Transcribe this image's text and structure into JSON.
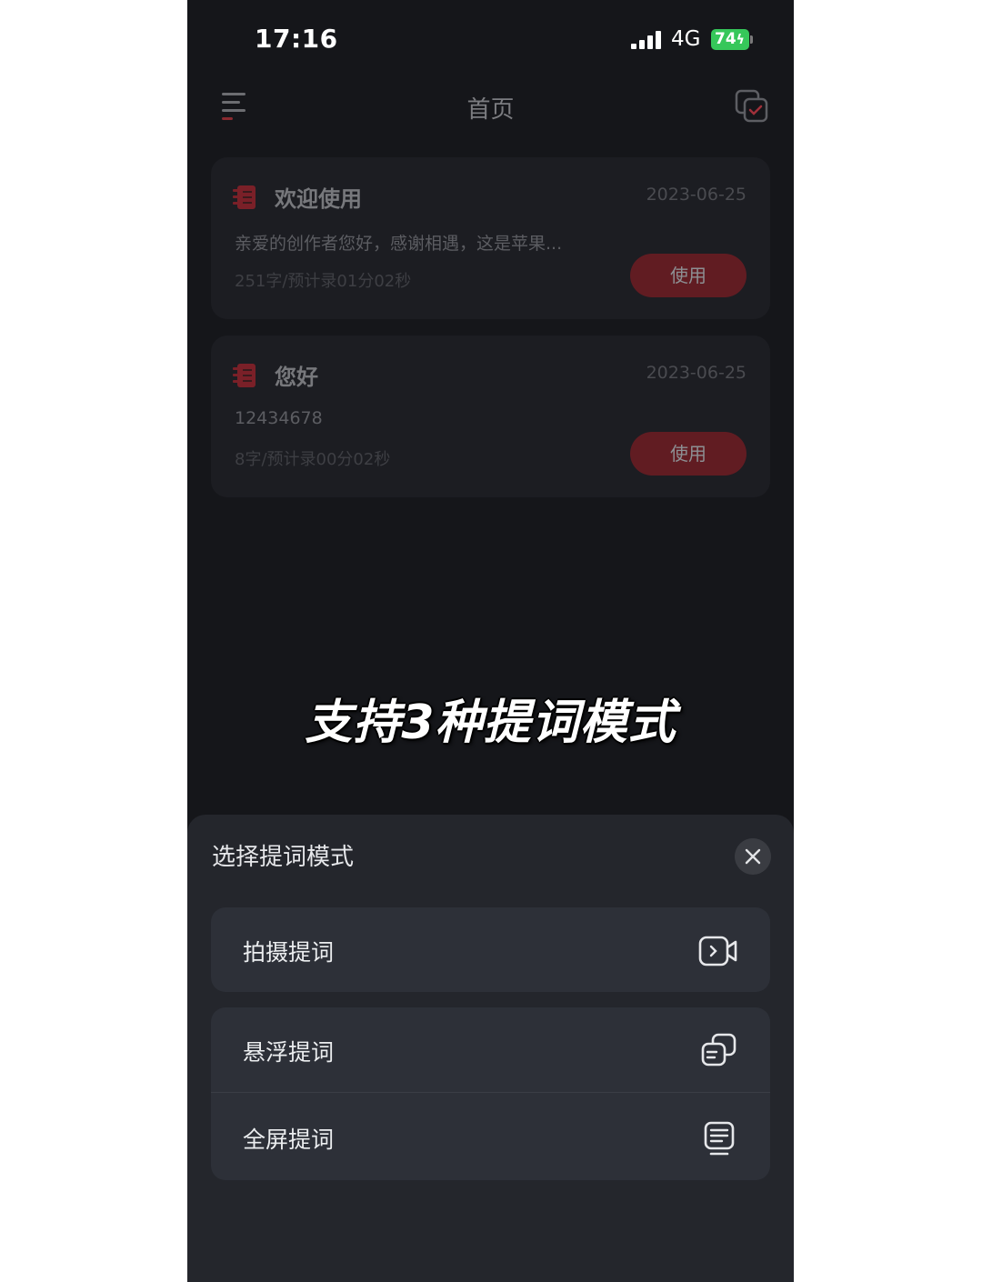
{
  "status_bar": {
    "time": "17:16",
    "network": "4G",
    "battery": "74"
  },
  "nav": {
    "title": "首页",
    "menu_icon": "menu-icon",
    "right_icon": "copy-check-icon"
  },
  "scripts": [
    {
      "title": "欢迎使用",
      "date": "2023-06-25",
      "preview": "亲爱的创作者您好，感谢相遇，这是苹果...",
      "meta": "251字/预计录01分02秒",
      "button": "使用"
    },
    {
      "title": "您好",
      "date": "2023-06-25",
      "preview": "12434678",
      "meta": "8字/预计录00分02秒",
      "button": "使用"
    }
  ],
  "caption": "支持3种提词模式",
  "sheet": {
    "title": "选择提词模式",
    "close_icon": "close-icon",
    "options": [
      {
        "label": "拍摄提词",
        "icon": "video-camera-icon"
      },
      {
        "label": "悬浮提词",
        "icon": "floating-window-icon"
      },
      {
        "label": "全屏提词",
        "icon": "fullscreen-text-icon"
      }
    ]
  },
  "colors": {
    "background": "#15161a",
    "card": "#1c1d22",
    "accent_red": "#c0323a",
    "sheet": "#24262c",
    "option": "#2d3038",
    "battery_green": "#36c75a"
  }
}
